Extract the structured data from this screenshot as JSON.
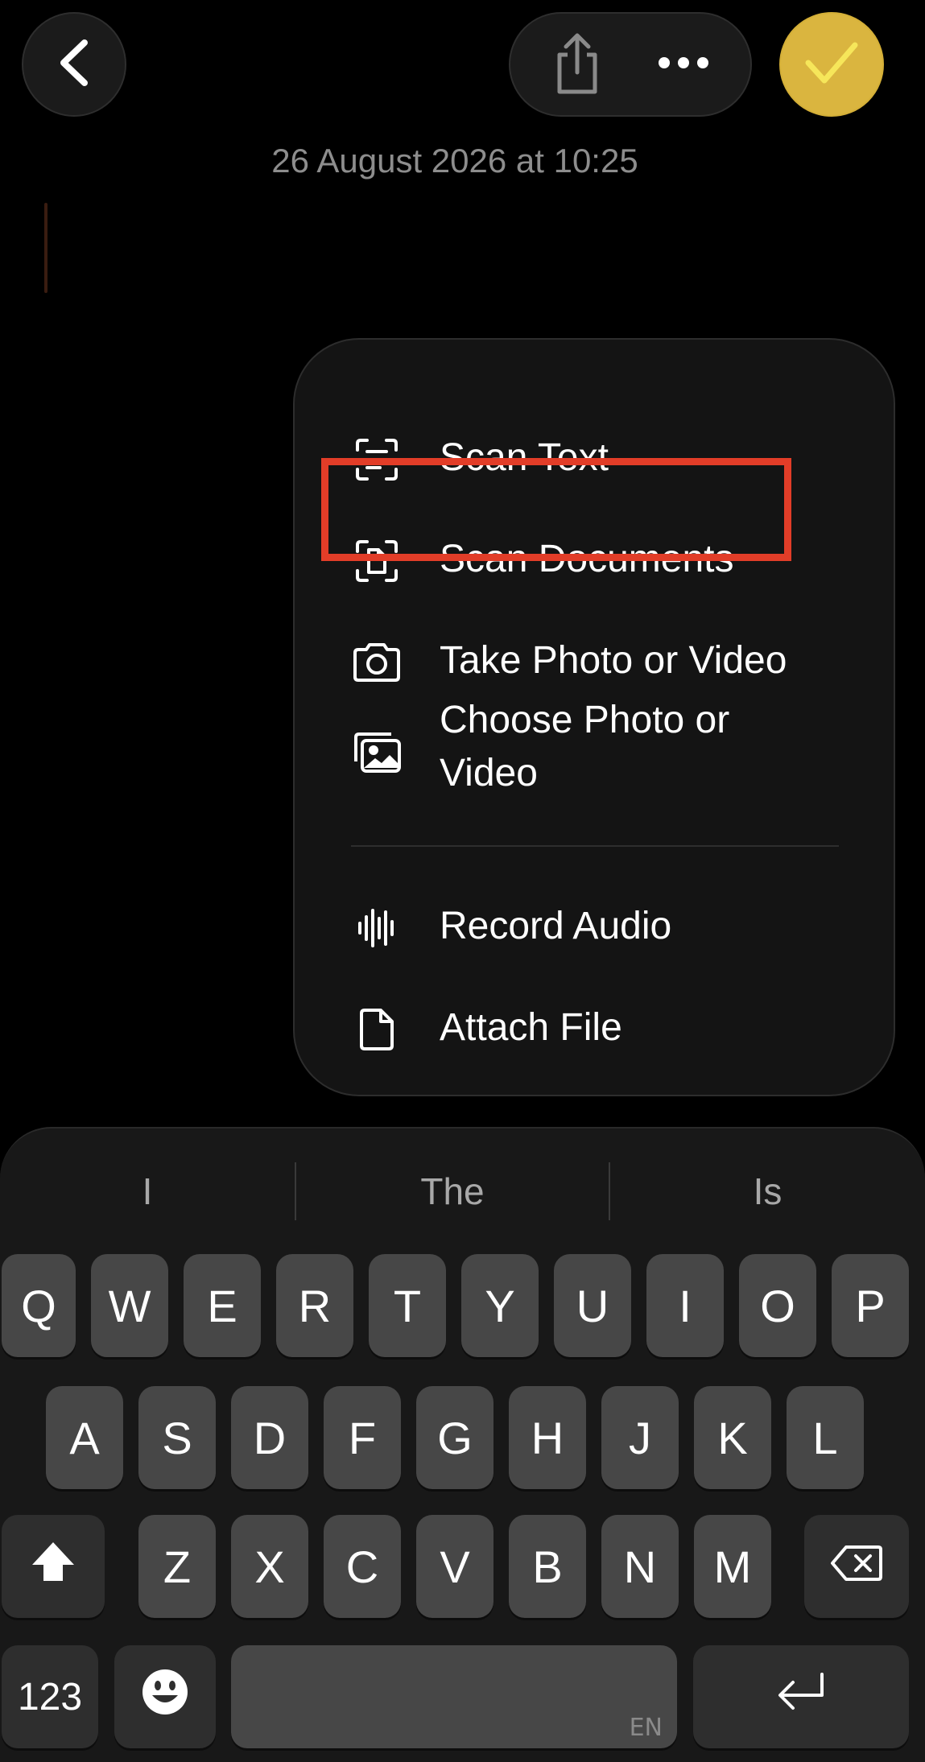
{
  "header": {
    "back_icon": "chevron-left-icon",
    "share_icon": "share-icon",
    "more_icon": "ellipsis-icon",
    "done_icon": "checkmark-icon",
    "accent_color": "#dab53f"
  },
  "note": {
    "timestamp": "26 August 2026 at 10:25"
  },
  "menu": {
    "items": [
      {
        "label": "Scan Text",
        "icon": "scan-text-icon"
      },
      {
        "label": "Scan Documents",
        "icon": "scan-document-icon"
      },
      {
        "label": "Take Photo or Video",
        "icon": "camera-icon"
      },
      {
        "label": "Choose Photo or Video",
        "icon": "photo-library-icon"
      },
      {
        "label": "Record Audio",
        "icon": "waveform-icon"
      },
      {
        "label": "Attach File",
        "icon": "document-icon"
      }
    ],
    "highlight_color": "#e23d28"
  },
  "keyboard": {
    "suggestions": [
      "I",
      "The",
      "Is"
    ],
    "row1": [
      "Q",
      "W",
      "E",
      "R",
      "T",
      "Y",
      "U",
      "I",
      "O",
      "P"
    ],
    "row2": [
      "A",
      "S",
      "D",
      "F",
      "G",
      "H",
      "J",
      "K",
      "L"
    ],
    "row3": [
      "Z",
      "X",
      "C",
      "V",
      "B",
      "N",
      "M"
    ],
    "numbers_label": "123",
    "space_language": "EN",
    "shift_icon": "shift-icon",
    "delete_icon": "delete-icon",
    "emoji_icon": "emoji-icon",
    "return_icon": "return-icon"
  }
}
